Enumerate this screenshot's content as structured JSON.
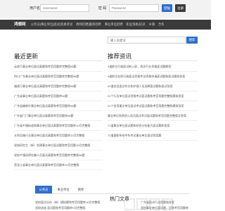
{
  "colors": {
    "brand_blue": "#2d6fcc",
    "nav_bg": "#3a3a3a",
    "login_bg": "#f2f2f2"
  },
  "login": {
    "username_label": "用户名",
    "username_placeholder": "Username",
    "password_label": "密 码",
    "password_placeholder": "Password",
    "login_button": "登陆",
    "register_button": "注册"
  },
  "nav": {
    "logo": "鸿想网",
    "items": [
      "公务员|事业单位|面试|资格考试",
      "教师招聘|最新招聘",
      "事业单位招聘",
      "职业资格|培训",
      "乡镇",
      "合作"
    ]
  },
  "search": {
    "placeholder": "输入关键词",
    "button": "搜索"
  },
  "left": {
    "title": "最近更新",
    "items": [
      "云南万事业单位面试真题和考官用题库完整版98题",
      "四川广东事业单位面试真题和考官用题库完整版98题",
      "福建万事业单位面试真题和考官用题库完整版98题",
      "广东省事业单位面试真题和考官用题库98题",
      "广东省编制外事业单位面试真题和考官用题库98题",
      "广东省门门事业单位面试真题和考官用题库98题",
      "广东省乡镇街道和事业单位面试真题和考官用题库10月完整版",
      "水利设施行业事业单位面试真题和考官用题库10月完整版",
      "党校研究生（新）党建事业单位面试题和考官用题10月完整版",
      "党校乡镇选择在编人员面试真题和考官用题库完整版98题",
      "黑龙江省事业单位面试真题和考官用题库10月完整版"
    ]
  },
  "right": {
    "title": "推荐资讯",
    "items": [
      "4道职位行政面试新入职，再次行业资格面试题解答",
      "4道职位在职行政面试资格考试资格申请面试题和面试模拟答案",
      "42道党员面试作文和护理人员选聘面试题和面试答案",
      "21个行业单位面试资格考试面试题和考官用题完整版模拟答案",
      "21个信用事业单位面试考试面试题和考官用题完整版模拟答案",
      "事业单位和其他公务员面试考试面试题和考官用题完整版及答案",
      "71道事业单位面试题和综合分析能力面试题和答案",
      "72道基职所给中年考试事业单位面试答案题"
    ]
  },
  "tabs": {
    "items": [
      "公务员",
      "事业单位",
      "教师"
    ],
    "active_index": 0
  },
  "bottom": {
    "title": "热门文章",
    "left_links": [
      "党校面试分析（新）模拟题和考官用题库10月完整版",
      "党校选拔 面试题和考官用题库9月完整版"
    ],
    "right_links": [
      "广东省面试行业用题和答案",
      "党校事业单位面试题，回答考官用题库"
    ]
  }
}
